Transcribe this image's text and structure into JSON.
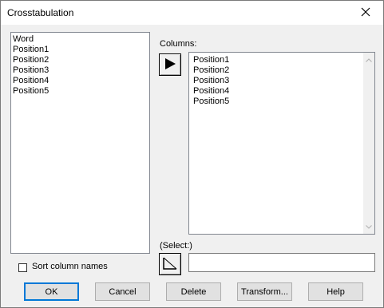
{
  "window": {
    "title": "Crosstabulation"
  },
  "source_list": {
    "items": [
      "Word",
      "Position1",
      "Position2",
      "Position3",
      "Position4",
      "Position5"
    ]
  },
  "columns": {
    "label": "Columns:",
    "items": [
      "Position1",
      "Position2",
      "Position3",
      "Position4",
      "Position5"
    ]
  },
  "select": {
    "label": "(Select:)",
    "value": ""
  },
  "sort": {
    "label": "Sort column names",
    "checked": false
  },
  "buttons": {
    "ok": "OK",
    "cancel": "Cancel",
    "delete": "Delete",
    "transform": "Transform...",
    "help": "Help"
  },
  "icons": {
    "close": "close-icon",
    "columns_arrow": "arrow-right-icon",
    "select_arrow": "select-arrow-icon",
    "scroll_up": "scroll-up-icon",
    "scroll_down": "scroll-down-icon"
  }
}
